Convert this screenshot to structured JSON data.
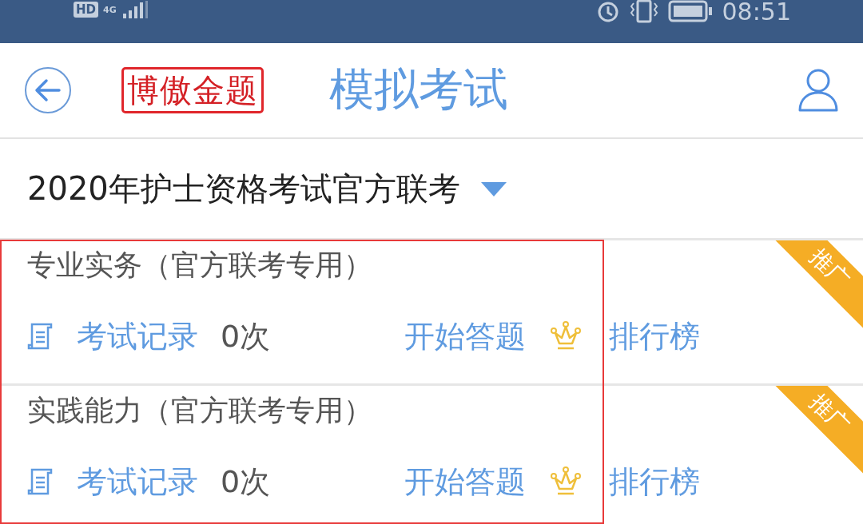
{
  "status_bar": {
    "hd": "HD",
    "network": "4G",
    "time": "08:51"
  },
  "header": {
    "logo": "博傲金题",
    "title": "模拟考试"
  },
  "exam_selector": {
    "label": "2020年护士资格考试官方联考",
    "expanded": false
  },
  "cards": [
    {
      "title": "专业实务（官方联考专用）",
      "record_label": "考试记录",
      "count": "0次",
      "start": "开始答题",
      "rank": "排行榜",
      "badge": "推广"
    },
    {
      "title": "实践能力（官方联考专用）",
      "record_label": "考试记录",
      "count": "0次",
      "start": "开始答题",
      "rank": "排行榜",
      "badge": "推广"
    }
  ]
}
